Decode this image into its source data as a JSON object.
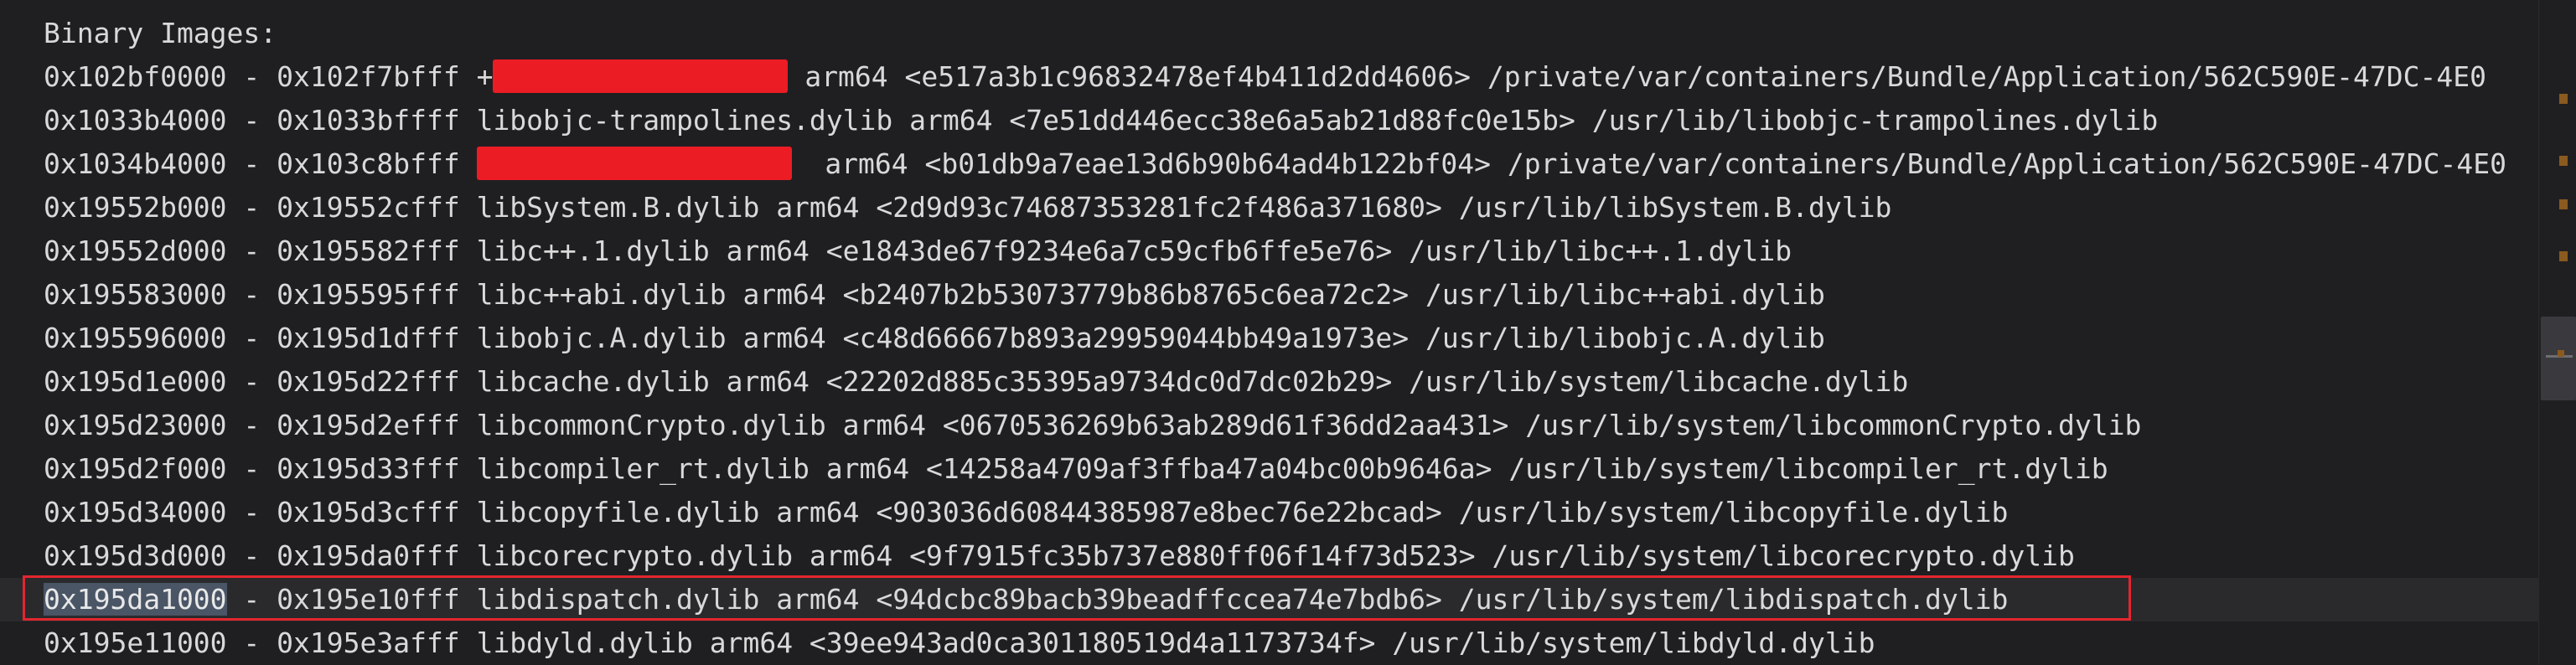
{
  "editor": {
    "colors": {
      "background": "#1f1f22",
      "text": "#d9d9d9",
      "current_line": "#2a2a2d",
      "selection": "#4a5566",
      "annotation_box": "#e3262f",
      "redaction": "#ec1c24",
      "scroll_marker": "#8a5a1e"
    },
    "header": "Binary Images:",
    "lines": [
      {
        "range": "0x102bf0000 - 0x102f7bfff",
        "prefix": " +",
        "redacted": true,
        "rest": " arm64 <e517a3b1c96832478ef4b411d2dd4606> /private/var/containers/Bundle/Application/562C590E-47DC-4E0"
      },
      {
        "range": "0x1033b4000 - 0x1033bffff",
        "rest": " libobjc-trampolines.dylib arm64 <7e51dd446ecc38e6a5ab21d88fc0e15b> /usr/lib/libobjc-trampolines.dylib"
      },
      {
        "range": "0x1034b4000 - 0x103c8bfff",
        "prefix": " ",
        "redacted": true,
        "rest": "  arm64 <b01db9a7eae13d6b90b64ad4b122bf04> /private/var/containers/Bundle/Application/562C590E-47DC-4E0"
      },
      {
        "range": "0x19552b000 - 0x19552cfff",
        "rest": " libSystem.B.dylib arm64 <2d9d93c74687353281fc2f486a371680> /usr/lib/libSystem.B.dylib"
      },
      {
        "range": "0x19552d000 - 0x195582fff",
        "rest": " libc++.1.dylib arm64 <e1843de67f9234e6a7c59cfb6ffe5e76> /usr/lib/libc++.1.dylib"
      },
      {
        "range": "0x195583000 - 0x195595fff",
        "rest": " libc++abi.dylib arm64 <b2407b2b53073779b86b8765c6ea72c2> /usr/lib/libc++abi.dylib"
      },
      {
        "range": "0x195596000 - 0x195d1dfff",
        "rest": " libobjc.A.dylib arm64 <c48d66667b893a29959044bb49a1973e> /usr/lib/libobjc.A.dylib"
      },
      {
        "range": "0x195d1e000 - 0x195d22fff",
        "rest": " libcache.dylib arm64 <22202d885c35395a9734dc0d7dc02b29> /usr/lib/system/libcache.dylib"
      },
      {
        "range": "0x195d23000 - 0x195d2efff",
        "rest": " libcommonCrypto.dylib arm64 <0670536269b63ab289d61f36dd2aa431> /usr/lib/system/libcommonCrypto.dylib"
      },
      {
        "range": "0x195d2f000 - 0x195d33fff",
        "rest": " libcompiler_rt.dylib arm64 <14258a4709af3ffba47a04bc00b9646a> /usr/lib/system/libcompiler_rt.dylib"
      },
      {
        "range": "0x195d34000 - 0x195d3cfff",
        "rest": " libcopyfile.dylib arm64 <903036d60844385987e8bec76e22bcad> /usr/lib/system/libcopyfile.dylib"
      },
      {
        "range": "0x195d3d000 - 0x195da0fff",
        "rest": " libcorecrypto.dylib arm64 <9f7915fc35b737e880ff06f14f73d523> /usr/lib/system/libcorecrypto.dylib"
      },
      {
        "selected": "0x195da1000",
        "range": " - 0x195e10fff",
        "rest": " libdispatch.dylib arm64 <94dcbc89bacb39beadffccea74e7bdb6> /usr/lib/system/libdispatch.dylib",
        "current": true
      },
      {
        "range": "0x195e11000 - 0x195e3afff",
        "rest": " libdyld.dylib arm64 <39ee943ad0ca301180519d4a1173734f> /usr/lib/system/libdyld.dylib"
      }
    ]
  }
}
